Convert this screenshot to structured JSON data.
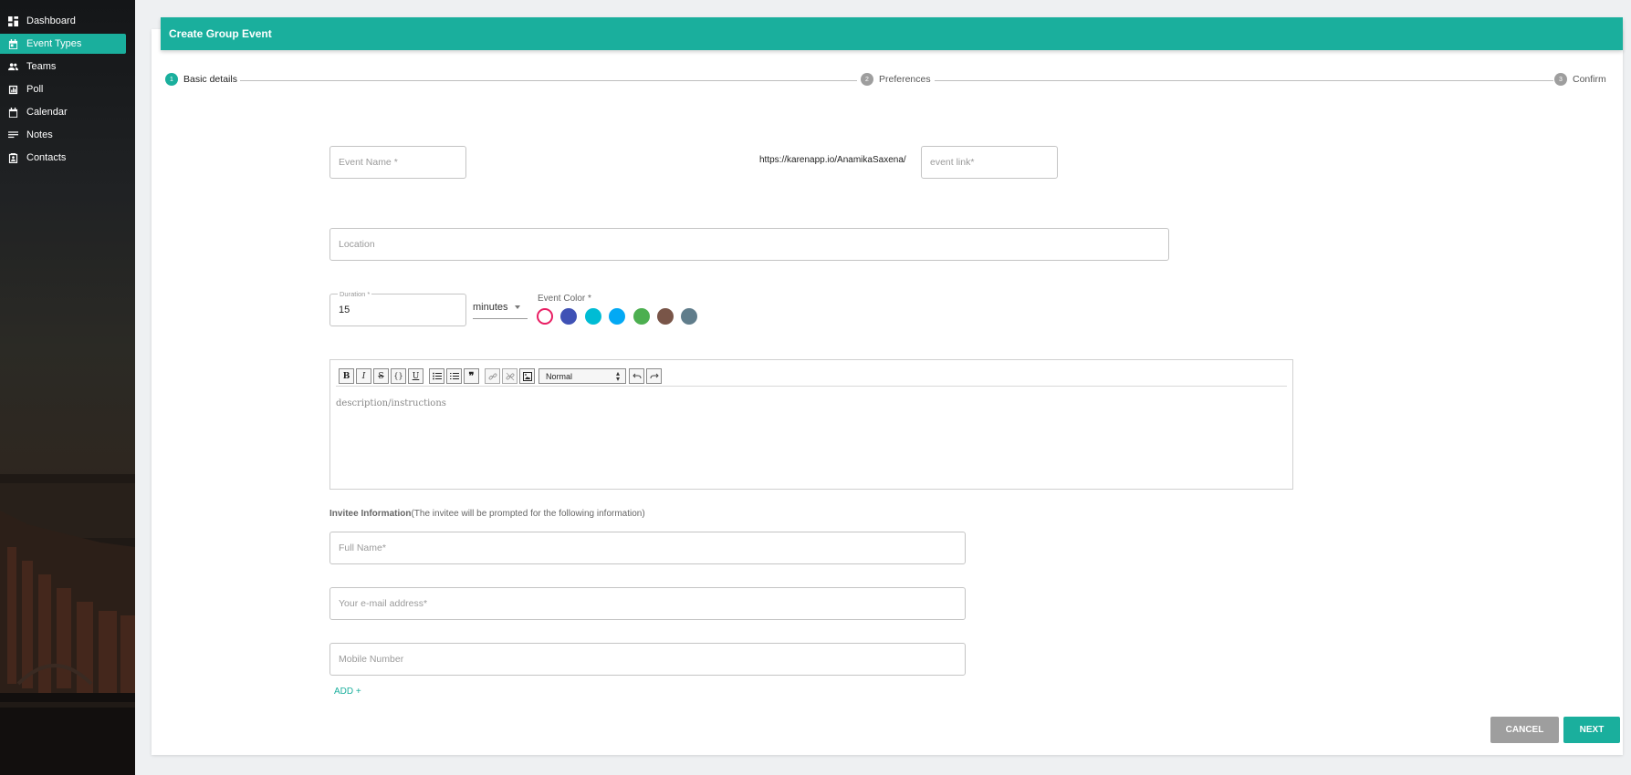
{
  "sidebar": {
    "items": [
      {
        "label": "Dashboard",
        "icon": "dashboard-icon",
        "active": false
      },
      {
        "label": "Event Types",
        "icon": "calendar-event-icon",
        "active": true
      },
      {
        "label": "Teams",
        "icon": "people-icon",
        "active": false
      },
      {
        "label": "Poll",
        "icon": "poll-icon",
        "active": false
      },
      {
        "label": "Calendar",
        "icon": "calendar-icon",
        "active": false
      },
      {
        "label": "Notes",
        "icon": "notes-icon",
        "active": false
      },
      {
        "label": "Contacts",
        "icon": "contacts-icon",
        "active": false
      }
    ]
  },
  "header": {
    "title": "Create Group Event"
  },
  "stepper": {
    "steps": [
      {
        "number": "1",
        "label": "Basic details",
        "active": true
      },
      {
        "number": "2",
        "label": "Preferences",
        "active": false
      },
      {
        "number": "3",
        "label": "Confirm",
        "active": false
      }
    ]
  },
  "form": {
    "event_name": {
      "placeholder": "Event Name *",
      "value": ""
    },
    "url_prefix": "https://karenapp.io/AnamikaSaxena/",
    "event_link": {
      "placeholder": "event link*",
      "value": ""
    },
    "location": {
      "placeholder": "Location",
      "value": ""
    },
    "duration": {
      "label": "Duration *",
      "value": "15"
    },
    "duration_unit": "minutes",
    "event_color": {
      "label": "Event Color *",
      "options": [
        "#e91e63",
        "#3f51b5",
        "#00bcd4",
        "#03a9f4",
        "#4caf50",
        "#795548",
        "#607d8b"
      ],
      "selected": "#e91e63"
    },
    "editor": {
      "placeholder": "description/instructions",
      "format": "Normal",
      "toolbar": [
        "bold",
        "italic",
        "strike",
        "code",
        "underline",
        "bullet-list",
        "ordered-list",
        "blockquote",
        "link",
        "unlink",
        "image",
        "undo",
        "redo"
      ]
    },
    "invitee": {
      "title": "Invitee Information",
      "subtitle": "(The invitee will be prompted for the following information)",
      "full_name": {
        "placeholder": "Full Name*"
      },
      "email": {
        "placeholder": "Your e-mail address*"
      },
      "mobile": {
        "placeholder": "Mobile Number"
      },
      "add_label": "ADD +"
    }
  },
  "actions": {
    "cancel": "CANCEL",
    "next": "NEXT"
  },
  "colors": {
    "accent": "#1aaf9d",
    "cancel": "#9e9e9e"
  }
}
